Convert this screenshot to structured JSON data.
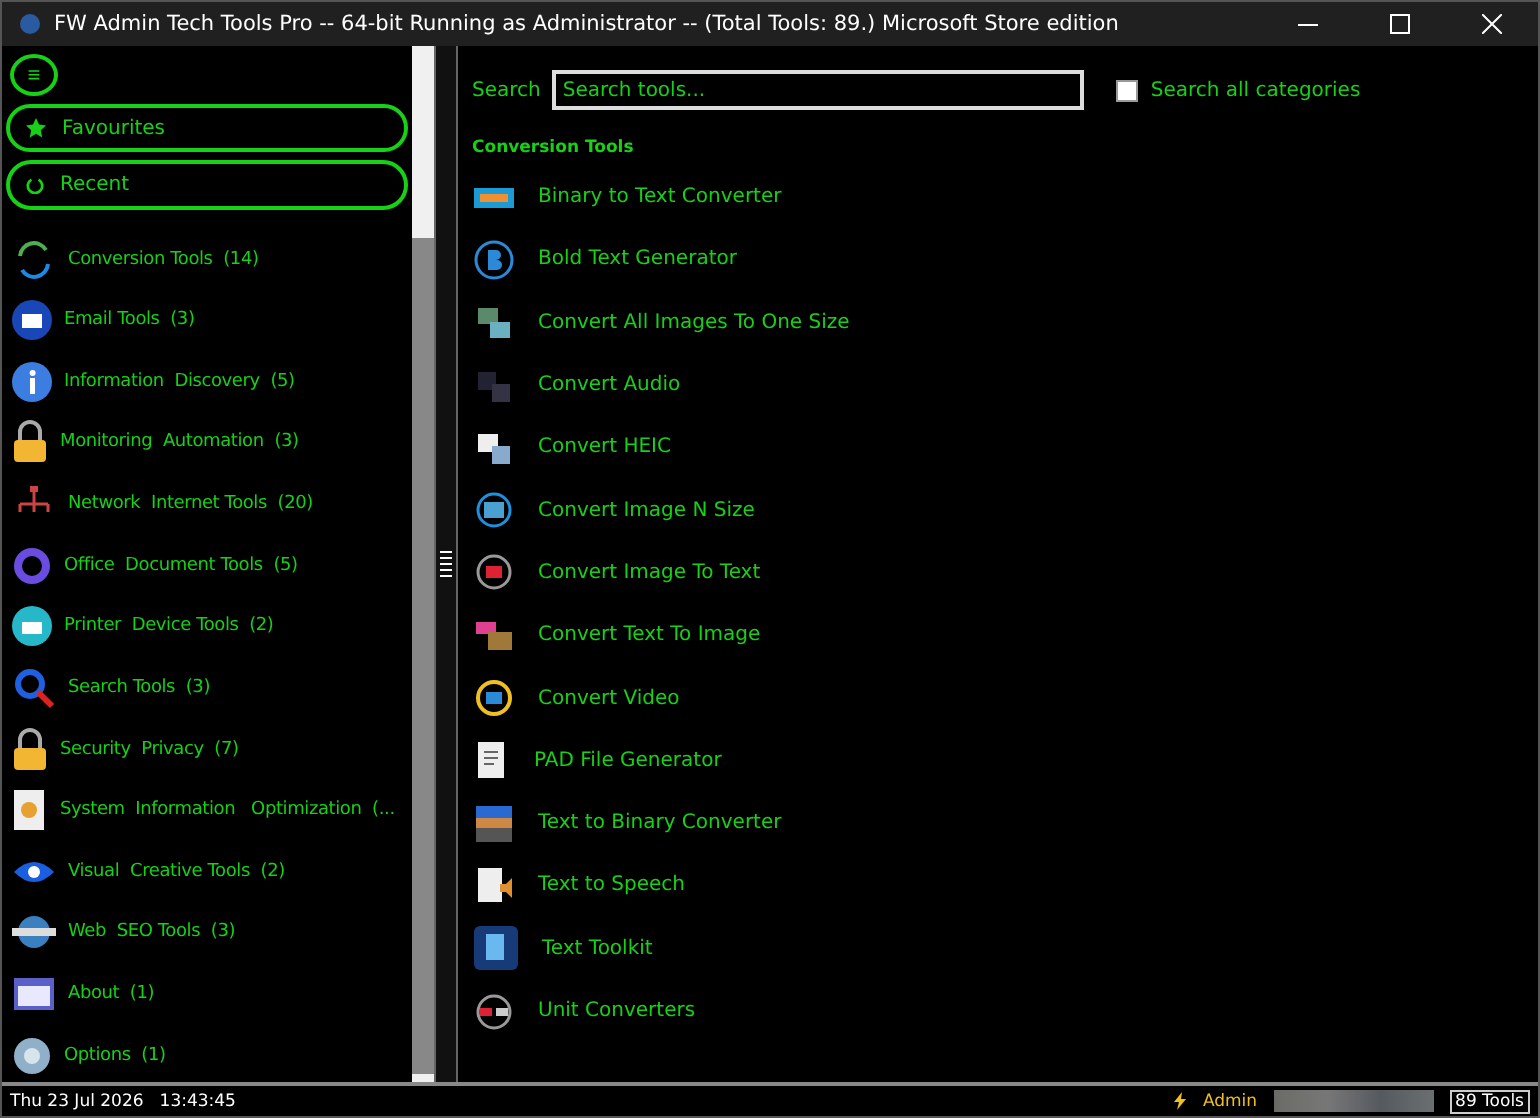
{
  "window": {
    "title": "FW Admin Tech Tools Pro -- 64-bit Running as Administrator -- (Total Tools: 89.) Microsoft Store edition"
  },
  "sidebar": {
    "menu_button": "≡",
    "pills": [
      {
        "label": "Favourites"
      },
      {
        "label": "Recent"
      }
    ],
    "items": [
      {
        "label": "Conversion Tools  (14)"
      },
      {
        "label": "Email Tools  (3)"
      },
      {
        "label": "Information  Discovery  (5)"
      },
      {
        "label": "Monitoring  Automation  (3)"
      },
      {
        "label": "Network  Internet Tools  (20)"
      },
      {
        "label": "Office  Document Tools  (5)"
      },
      {
        "label": "Printer  Device Tools  (2)"
      },
      {
        "label": "Search Tools  (3)"
      },
      {
        "label": "Security  Privacy  (7)"
      },
      {
        "label": "System  Information   Optimization  (..."
      },
      {
        "label": "Visual  Creative Tools  (2)"
      },
      {
        "label": "Web  SEO Tools  (3)"
      },
      {
        "label": "About  (1)"
      },
      {
        "label": "Options  (1)"
      }
    ]
  },
  "search": {
    "label": "Search",
    "placeholder": "Search tools...",
    "all_categories": {
      "label": "Search all categories",
      "checked": false
    }
  },
  "section_title": "Conversion Tools",
  "tools": [
    {
      "label": "Binary to Text Converter"
    },
    {
      "label": "Bold Text Generator"
    },
    {
      "label": "Convert All Images To One Size"
    },
    {
      "label": "Convert Audio"
    },
    {
      "label": "Convert HEIC"
    },
    {
      "label": "Convert Image N Size"
    },
    {
      "label": "Convert Image To Text"
    },
    {
      "label": "Convert Text To Image"
    },
    {
      "label": "Convert Video"
    },
    {
      "label": "PAD File Generator"
    },
    {
      "label": "Text to Binary Converter"
    },
    {
      "label": "Text to Speech"
    },
    {
      "label": "Text Toolkit"
    },
    {
      "label": "Unit Converters"
    }
  ],
  "status_bar": {
    "date": "Thu 23 Jul 2026",
    "time": "13:43:45",
    "user": "Admin",
    "tool_count": "89 Tools"
  }
}
